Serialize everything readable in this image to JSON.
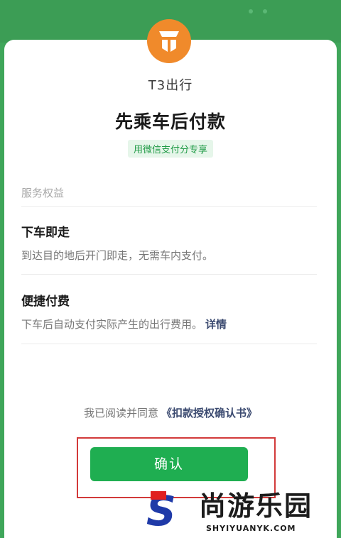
{
  "app": {
    "name": "T3出行",
    "brand_color": "#f08a2b",
    "logo_icon": "t3-logo-icon"
  },
  "header": {
    "title": "先乘车后付款",
    "tag": "用微信支付分专享"
  },
  "benefits": {
    "section_label": "服务权益",
    "items": [
      {
        "title": "下车即走",
        "desc": "到达目的地后开门即走，无需车内支付。",
        "link": ""
      },
      {
        "title": "便捷付费",
        "desc": "下车后自动支付实际产生的出行费用。",
        "link": "详情"
      }
    ]
  },
  "agreement": {
    "text": "我已阅读并同意",
    "link": "《扣款授权确认书》"
  },
  "confirm": {
    "label": "确认",
    "color": "#1fae51"
  },
  "watermark": {
    "letter": "S",
    "name": "尚游乐园",
    "domain": "SHYIYUANYK.COM"
  }
}
